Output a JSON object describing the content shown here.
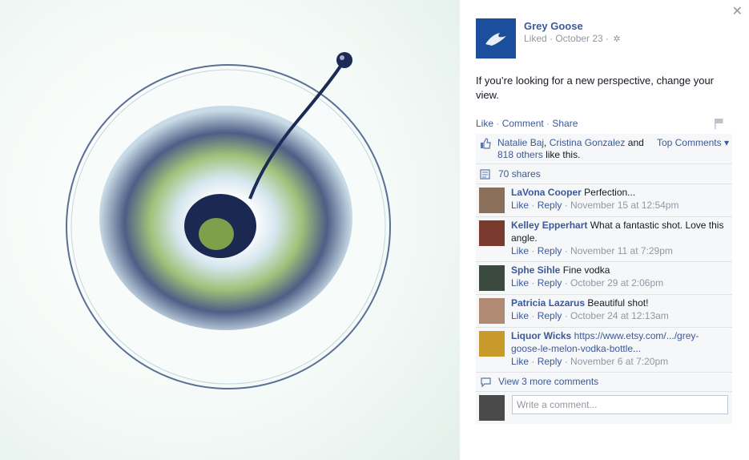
{
  "post": {
    "page_name": "Grey Goose",
    "meta": "Liked · October 23 ·",
    "message": "If you’re looking for a new perspective, change your view.",
    "actions": {
      "like": "Like",
      "comment": "Comment",
      "share": "Share"
    }
  },
  "likes": {
    "name1": "Natalie Baj",
    "name2": "Cristina Gonzalez",
    "and": "and",
    "others": "818 others",
    "suffix": "like this.",
    "top_comments": "Top Comments ▾"
  },
  "shares": "70 shares",
  "comments": [
    {
      "author": "LaVona Cooper",
      "text": "Perfection...",
      "like": "Like",
      "reply": "Reply",
      "time": "November 15 at 12:54pm",
      "avatar_color": "#8a6f5a"
    },
    {
      "author": "Kelley Epperhart",
      "text": "What a fantastic shot. Love this angle.",
      "like": "Like",
      "reply": "Reply",
      "time": "November 11 at 7:29pm",
      "avatar_color": "#7a3b2e"
    },
    {
      "author": "Sphe Sihle",
      "text": "Fine vodka",
      "like": "Like",
      "reply": "Reply",
      "time": "October 29 at 2:06pm",
      "avatar_color": "#3a4a3e"
    },
    {
      "author": "Patricia Lazarus",
      "text": "Beautiful shot!",
      "like": "Like",
      "reply": "Reply",
      "time": "October 24 at 12:13am",
      "avatar_color": "#b08a72"
    },
    {
      "author": "Liquor Wicks",
      "link": "https://www.etsy.com/.../grey-goose-le-melon-vodka-bottle...",
      "like": "Like",
      "reply": "Reply",
      "time": "November 6 at 7:20pm",
      "avatar_color": "#c89a2a"
    }
  ],
  "view_more": "View 3 more comments",
  "composer": {
    "placeholder": "Write a comment..."
  },
  "colors": {
    "link": "#3b5998",
    "muted": "#9197a3",
    "ufi_bg": "#f6f7f9",
    "logo_bg": "#1b4e9c"
  },
  "icons": {
    "close": "close-icon",
    "gear": "gear-icon",
    "flag": "flag-icon",
    "thumb": "thumbs-up-icon",
    "shares": "share-icon",
    "comments": "comment-bubble-icon"
  }
}
